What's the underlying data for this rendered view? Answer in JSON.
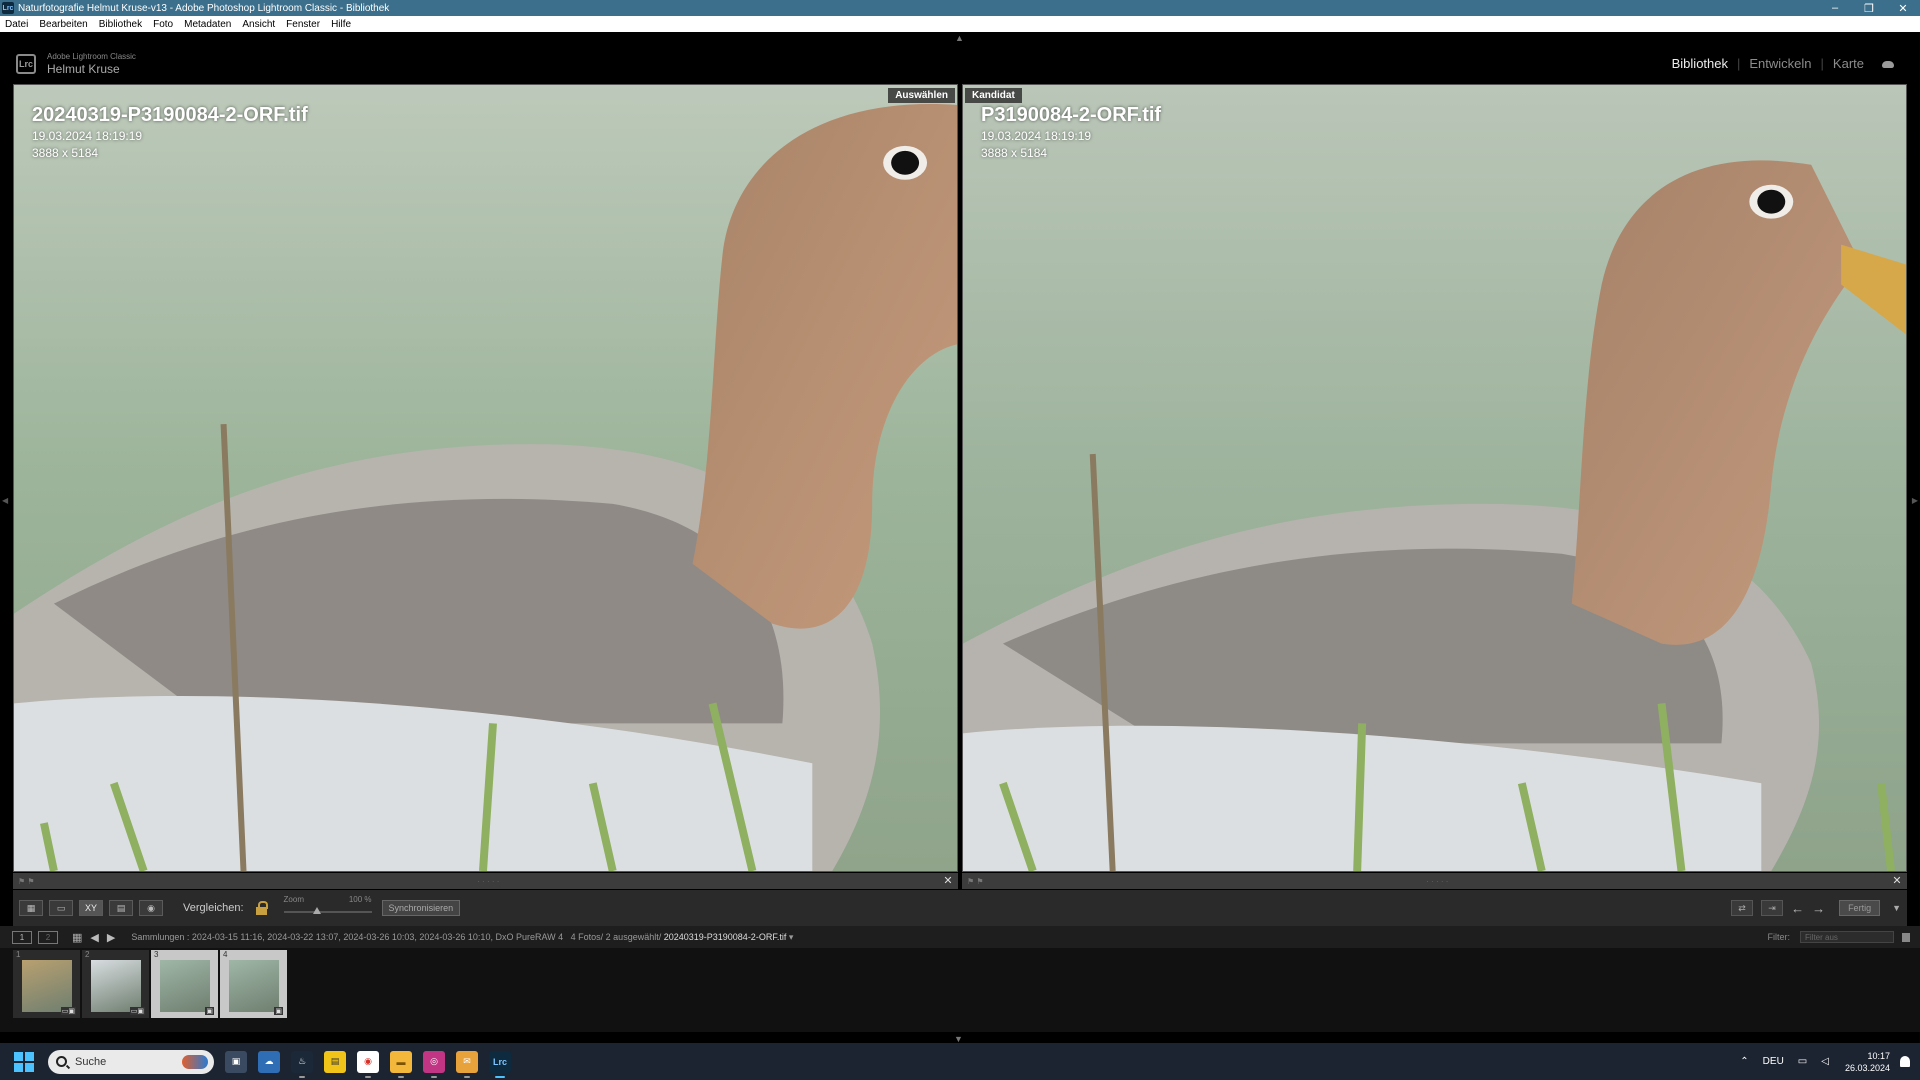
{
  "window": {
    "app_icon": "Lrc",
    "title": "Naturfotografie Helmut Kruse-v13 - Adobe Photoshop Lightroom Classic - Bibliothek",
    "minimize": "–",
    "restore": "❐",
    "close": "✕"
  },
  "menu": {
    "items": [
      "Datei",
      "Bearbeiten",
      "Bibliothek",
      "Foto",
      "Metadaten",
      "Ansicht",
      "Fenster",
      "Hilfe"
    ]
  },
  "identity": {
    "badge": "Lrc",
    "product": "Adobe Lightroom Classic",
    "user": "Helmut Kruse"
  },
  "modules": {
    "items": [
      {
        "label": "Bibliothek",
        "active": true
      },
      {
        "label": "Entwickeln",
        "active": false
      },
      {
        "label": "Karte",
        "active": false
      }
    ]
  },
  "compare": {
    "select": {
      "tag": "Auswählen",
      "filename": "20240319-P3190084-2-ORF.tif",
      "date": "19.03.2024 18:19:19",
      "dimensions": "3888 x 5184"
    },
    "candidate": {
      "tag": "Kandidat",
      "filename": "P3190084-2-ORF.tif",
      "date": "19.03.2024 18:19:19",
      "dimensions": "3888 x 5184"
    }
  },
  "toolbar": {
    "view_buttons": [
      "grid",
      "loupe",
      "XY",
      "survey",
      "people"
    ],
    "compare_label": "Vergleichen:",
    "zoom_label": "Zoom",
    "zoom_value": "100 %",
    "zoom_fraction": 0.4,
    "sync_label": "Synchronisieren",
    "done_label": "Fertig"
  },
  "filmstrip_header": {
    "monitor1": "1",
    "monitor2": "2",
    "path": "Sammlungen : 2024-03-15 11:16, 2024-03-22 13:07, 2024-03-26 10:03, 2024-03-26 10:10, DxO PureRAW 4",
    "count": "4 Fotos/ 2 ausgewählt/",
    "current": "20240319-P3190084-2-ORF.tif",
    "filter_label": "Filter:",
    "filter_value": "Filter aus"
  },
  "filmstrip": {
    "thumbs": [
      {
        "num": "1",
        "selected": false,
        "badges": "▭▣",
        "tone": "#b8a070"
      },
      {
        "num": "2",
        "selected": false,
        "badges": "▭▣",
        "tone": "#d8dde0"
      },
      {
        "num": "3",
        "selected": true,
        "badges": "▣",
        "tone": "#9fb6a6"
      },
      {
        "num": "4",
        "selected": true,
        "badges": "▣",
        "tone": "#9fb6a6"
      }
    ]
  },
  "taskbar": {
    "search_placeholder": "Suche",
    "language": "DEU",
    "time": "10:17",
    "date": "26.03.2024"
  },
  "colors": {
    "titlebar": "#3b6f8c",
    "windows_accent": "#4cc2ff",
    "lock": "#c8a040"
  }
}
